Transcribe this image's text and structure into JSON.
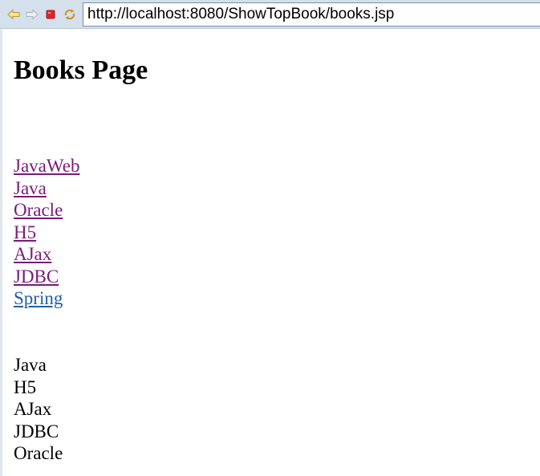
{
  "browser": {
    "url": "http://localhost:8080/ShowTopBook/books.jsp",
    "toolbar_icons": [
      "back-arrow-icon",
      "forward-arrow-icon",
      "stop-icon",
      "refresh-icon"
    ]
  },
  "page": {
    "title": "Books Page",
    "book_links": [
      {
        "label": "JavaWeb",
        "visited": true
      },
      {
        "label": "Java",
        "visited": true
      },
      {
        "label": "Oracle",
        "visited": true
      },
      {
        "label": "H5",
        "visited": true
      },
      {
        "label": "AJax",
        "visited": true
      },
      {
        "label": "JDBC",
        "visited": true
      },
      {
        "label": "Spring",
        "visited": false
      }
    ],
    "top_books": [
      "Java",
      "H5",
      "AJax",
      "JDBC",
      "Oracle"
    ]
  },
  "colors": {
    "visited_link": "#7a1a7a",
    "unvisited_link": "#1f5fa8",
    "toolbar_bg": "#d4e0ec",
    "stop_red": "#e0242a"
  }
}
